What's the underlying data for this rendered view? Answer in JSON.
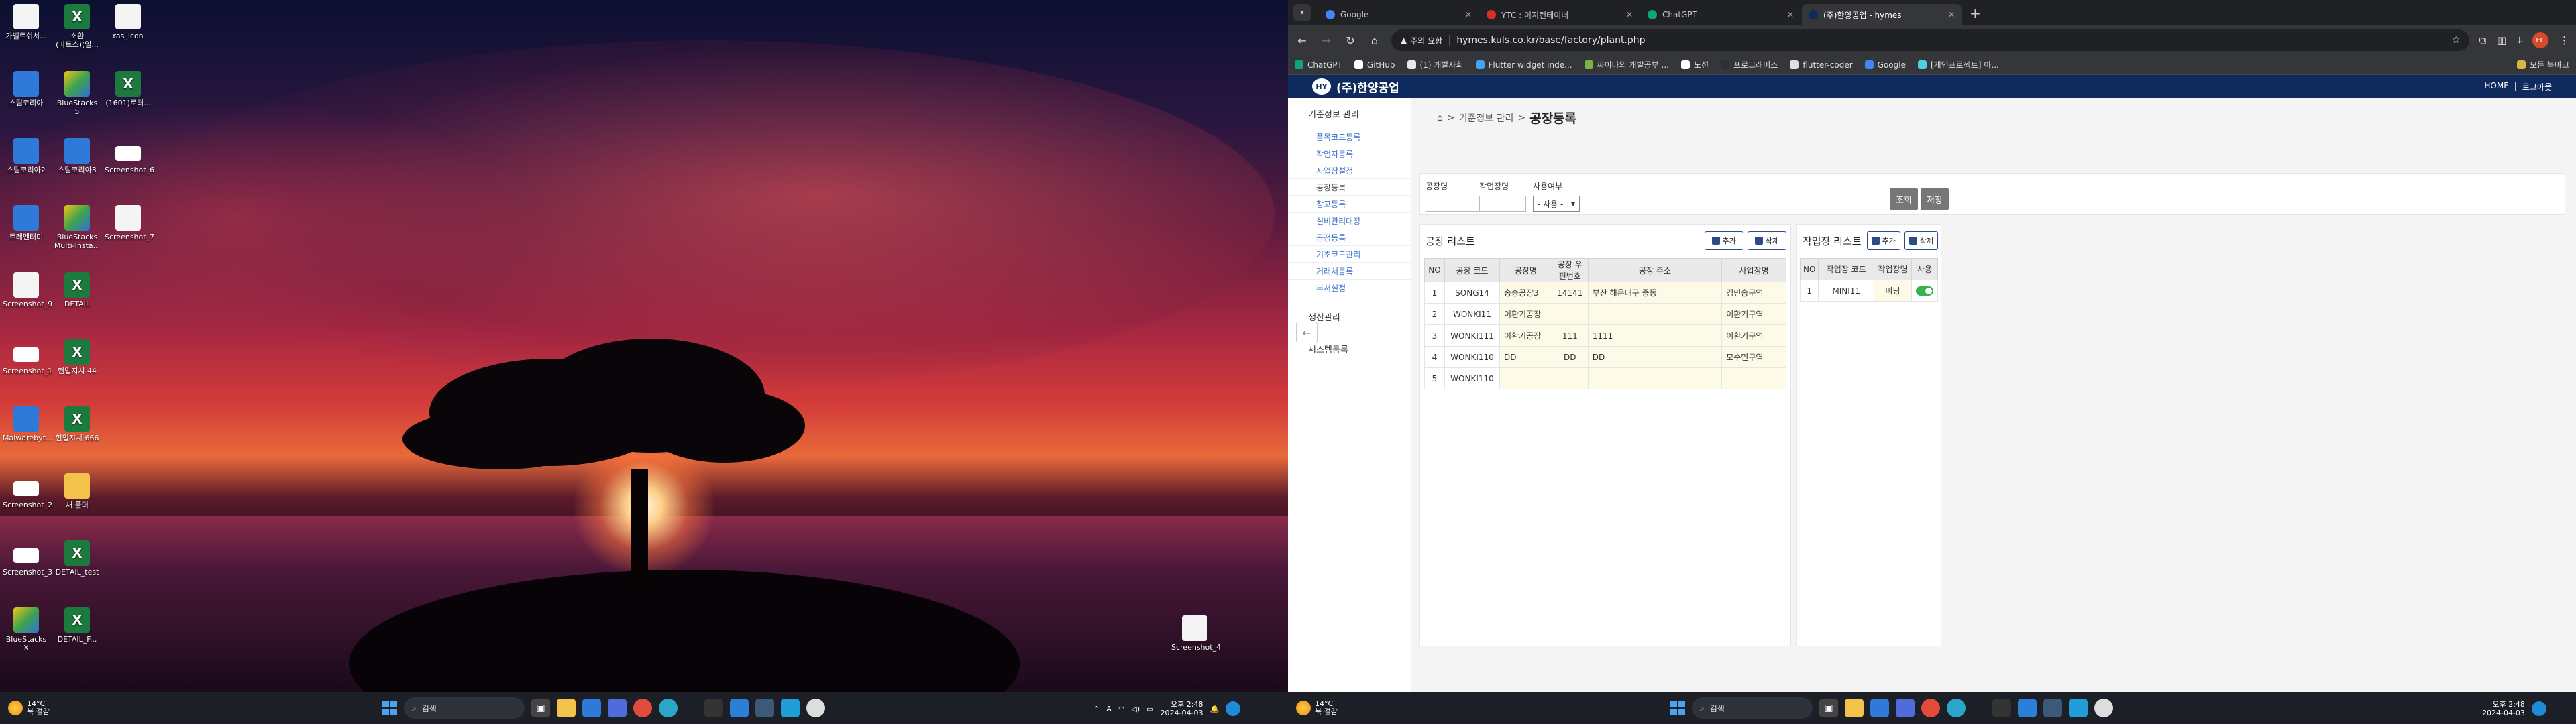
{
  "desktop": {
    "icons": [
      {
        "label": "가벨트쉬서...",
        "kind": "doc"
      },
      {
        "label": "소환\n(파트스)(일...",
        "kind": "xl"
      },
      {
        "label": "ras_icon",
        "kind": "doc"
      },
      {
        "label": "스팀코리아",
        "kind": "blue"
      },
      {
        "label": "BlueStacks 5",
        "kind": "bs"
      },
      {
        "label": "(1601)로터...",
        "kind": "xl"
      },
      {
        "label": "스팀코리아2",
        "kind": "blue"
      },
      {
        "label": "스팀코리아3",
        "kind": "blue"
      },
      {
        "label": "Screenshot_6",
        "kind": "shot"
      },
      {
        "label": "트레멘터미",
        "kind": "blue"
      },
      {
        "label": "BlueStacks Multi-Insta...",
        "kind": "bs"
      },
      {
        "label": "Screenshot_7",
        "kind": "doc"
      },
      {
        "label": "Screenshot_9",
        "kind": "doc"
      },
      {
        "label": "DETAIL",
        "kind": "xl"
      },
      {
        "label": "Screenshot_1",
        "kind": "shot"
      },
      {
        "label": "현업지시 44",
        "kind": "xl"
      },
      {
        "label": "Malwarebyt...",
        "kind": "blue"
      },
      {
        "label": "현업지시 666",
        "kind": "xl"
      },
      {
        "label": "Screenshot_2",
        "kind": "shot"
      },
      {
        "label": "새 폴더",
        "kind": "folder"
      },
      {
        "label": "Screenshot_3",
        "kind": "shot"
      },
      {
        "label": "DETAIL_test",
        "kind": "xl"
      },
      {
        "label": "BlueStacks X",
        "kind": "bs"
      },
      {
        "label": "DETAIL_F...",
        "kind": "xl"
      },
      {
        "label": "Screenshot_4",
        "kind": "doc"
      }
    ]
  },
  "taskbar": {
    "weather_temp": "14°C",
    "weather_desc": "북 걸감",
    "search_placeholder": "검색",
    "time": "오후 2:48",
    "date": "2024-04-03",
    "ime": "A",
    "apps": [
      "explorer",
      "folder",
      "edge",
      "store",
      "chrome",
      "edge-beta",
      "app",
      "vscode",
      "app2",
      "app3",
      "github"
    ]
  },
  "browser": {
    "tabs": [
      {
        "title": "Google",
        "color": "#4285f4",
        "active": false
      },
      {
        "title": "YTC : 이지컨테이너",
        "color": "#d93025",
        "active": false
      },
      {
        "title": "ChatGPT",
        "color": "#10a37f",
        "active": false
      },
      {
        "title": "(주)한양공업 - hymes",
        "color": "#0f2a5c",
        "active": true
      }
    ],
    "security_label": "주의 요함",
    "url": "hymes.kuls.co.kr/base/factory/plant.php",
    "profile_initial": "EC",
    "bookmarks": [
      {
        "label": "ChatGPT",
        "color": "#10a37f"
      },
      {
        "label": "GitHub",
        "color": "#ffffff"
      },
      {
        "label": "(1) 개발자회",
        "color": "#e8e8e8"
      },
      {
        "label": "Flutter widget inde...",
        "color": "#42a5f5"
      },
      {
        "label": "짜이다의 개발공부 ...",
        "color": "#7cb342"
      },
      {
        "label": "노션",
        "color": "#ffffff"
      },
      {
        "label": "프로그래머스",
        "color": "#263238"
      },
      {
        "label": "flutter-coder",
        "color": "#e0e0e0"
      },
      {
        "label": "Google",
        "color": "#4285f4"
      },
      {
        "label": "[개인프로젝트] 아...",
        "color": "#4dd0e1"
      }
    ],
    "bookmarks_right": "모든 북마크"
  },
  "site": {
    "logo_text": "(주)한양공업",
    "logo_mark": "HY",
    "header_links": [
      "HOME",
      "|",
      "로그아웃"
    ],
    "sidebar": {
      "category1": "기준정보 관리",
      "items": [
        "품목코드등록",
        "작업자등록",
        "사업장설정",
        "공장등록",
        "창고등록",
        "설비관리대장",
        "공정등록",
        "기초코드관리",
        "거래처등록",
        "부서설정"
      ],
      "current_index": 3,
      "category2": "생산관리",
      "category3": "시스템등록"
    },
    "breadcrumb": {
      "parent": "기준정보 관리",
      "current": "공장등록",
      "sep": ">"
    },
    "filters": {
      "plant_name_label": "공장명",
      "workplace_name_label": "작업장명",
      "use_label": "사용여부",
      "use_value": "- 사용 -"
    },
    "buttons": {
      "search": "조회",
      "save": "저장",
      "add": "추가",
      "delete": "삭제"
    },
    "plant_list": {
      "title": "공장 리스트",
      "columns": [
        "NO",
        "공장 코드",
        "공장명",
        "공장 우편번호",
        "공장 주소",
        "사업장명"
      ],
      "rows": [
        [
          "1",
          "SONG14",
          "송송공장3",
          "14141",
          "부산 해운대구 중동",
          "김민송구역"
        ],
        [
          "2",
          "WONKI11",
          "이환기공장",
          "",
          "",
          "이환기구역"
        ],
        [
          "3",
          "WONKI111",
          "이환기공장",
          "111",
          "1111",
          "이환기구역"
        ],
        [
          "4",
          "WONKI110",
          "DD",
          "DD",
          "DD",
          "모수민구역"
        ],
        [
          "5",
          "WONKI110",
          "",
          "",
          "",
          ""
        ]
      ]
    },
    "workplace_list": {
      "title": "작업장 리스트",
      "columns": [
        "NO",
        "작업장 코드",
        "작업장명",
        "사용"
      ],
      "rows": [
        [
          "1",
          "MINI11",
          "미닝",
          true
        ]
      ]
    }
  }
}
